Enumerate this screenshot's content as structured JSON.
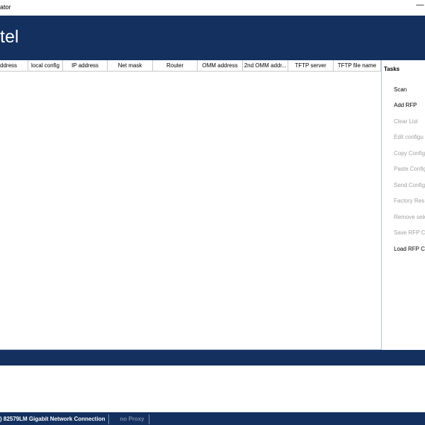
{
  "window": {
    "title": "ator",
    "minimize_glyph": "—"
  },
  "banner": {
    "logo_text": "tel",
    "color": "#13305f"
  },
  "table": {
    "columns": [
      "ddress",
      "local config",
      "IP address",
      "Net mask",
      "Router",
      "OMM address",
      "2nd OMM addr...",
      "TFTP server",
      "TFTP file name"
    ],
    "rows": []
  },
  "tasks": {
    "heading": "Tasks",
    "items": [
      {
        "label": "Scan",
        "enabled": true
      },
      {
        "label": "Add RFP",
        "enabled": true
      },
      {
        "label": "Clear List",
        "enabled": false
      },
      {
        "label": "Edit configu",
        "enabled": false
      },
      {
        "label": "Copy Config",
        "enabled": false
      },
      {
        "label": "Paste Config",
        "enabled": false
      },
      {
        "label": "Send Config",
        "enabled": false
      },
      {
        "label": "Factory Res",
        "enabled": false
      },
      {
        "label": "Remove sele",
        "enabled": false
      },
      {
        "label": "Save RFP Co",
        "enabled": false
      },
      {
        "label": "Load RFP Co",
        "enabled": true
      }
    ]
  },
  "statusbar": {
    "adapter": ") 82579LM Gigabit Network Connection",
    "proxy": "no Proxy"
  }
}
